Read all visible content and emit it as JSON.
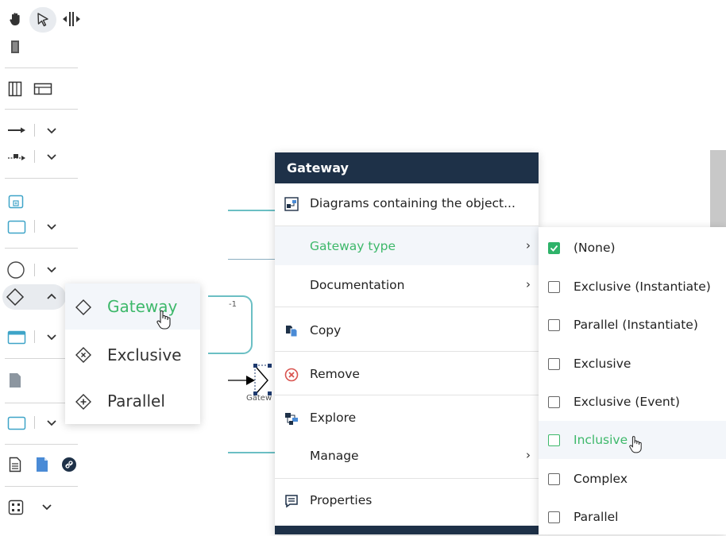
{
  "palette": {
    "header_bg": "#1e3148",
    "accent_green": "#3db86a",
    "checkbox_green": "#2fb36a",
    "hover_bg": "#f3f6fa",
    "teal_line": "#6bbfc4"
  },
  "toolbar": {
    "icons": [
      "hand-icon",
      "pointer-icon",
      "space-tool-icon",
      "lasso-icon",
      "pool-icon",
      "lane-icon",
      "sequence-flow-icon",
      "message-flow-icon",
      "subprocess-icon",
      "task-icon",
      "event-icon",
      "gateway-icon",
      "data-icon",
      "document-icon",
      "group-icon",
      "note-icon",
      "file-icon",
      "document-fill-icon",
      "link-icon",
      "grid-icon"
    ]
  },
  "canvas": {
    "partial_label": "-1",
    "gateway_label": "Gatew"
  },
  "flyout": {
    "items": [
      {
        "label": "Gateway",
        "icon": "gateway-diamond-icon",
        "active": true
      },
      {
        "label": "Exclusive",
        "icon": "exclusive-diamond-icon",
        "active": false
      },
      {
        "label": "Parallel",
        "icon": "parallel-diamond-icon",
        "active": false
      }
    ]
  },
  "context_menu": {
    "title": "Gateway",
    "items": [
      {
        "label": "Diagrams containing the object...",
        "icon": "diagrams-icon",
        "submenu": false
      },
      {
        "label": "Gateway type",
        "icon": "",
        "submenu": true,
        "active": true
      },
      {
        "label": "Documentation",
        "icon": "",
        "submenu": true
      },
      {
        "label": "Copy",
        "icon": "copy-icon",
        "submenu": false
      },
      {
        "label": "Remove",
        "icon": "remove-icon",
        "submenu": false
      },
      {
        "label": "Explore",
        "icon": "explore-icon",
        "submenu": false
      },
      {
        "label": "Manage",
        "icon": "",
        "submenu": true
      },
      {
        "label": "Properties",
        "icon": "properties-icon",
        "submenu": false
      }
    ],
    "arrow": "›"
  },
  "gateway_type_submenu": {
    "items": [
      {
        "label": "(None)",
        "checked": true
      },
      {
        "label": "Exclusive (Instantiate)",
        "checked": false
      },
      {
        "label": "Parallel (Instantiate)",
        "checked": false
      },
      {
        "label": "Exclusive",
        "checked": false
      },
      {
        "label": "Exclusive (Event)",
        "checked": false
      },
      {
        "label": "Inclusive",
        "checked": false,
        "active": true
      },
      {
        "label": "Complex",
        "checked": false
      },
      {
        "label": "Parallel",
        "checked": false
      }
    ]
  }
}
